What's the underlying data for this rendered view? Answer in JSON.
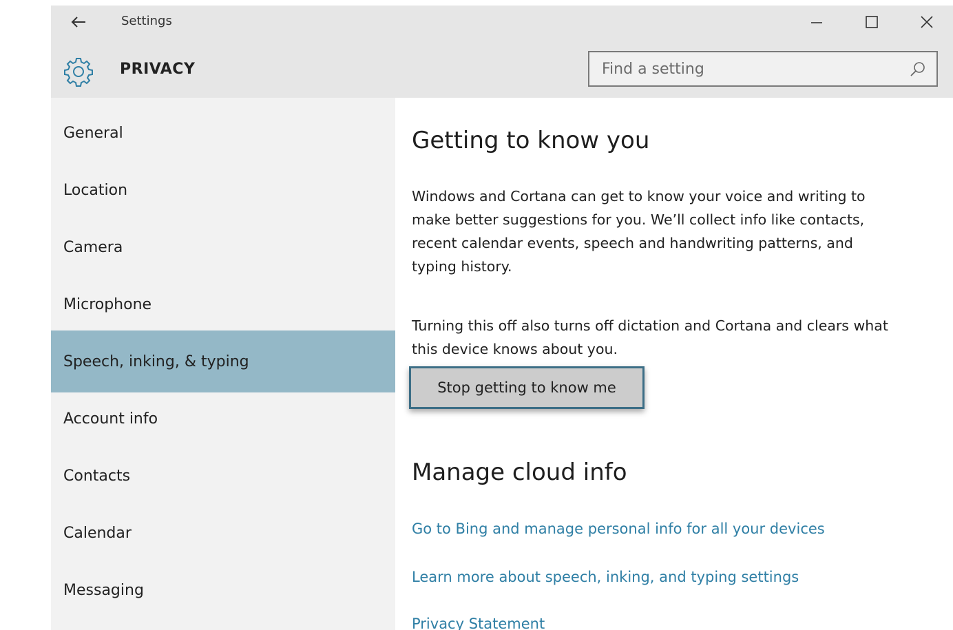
{
  "window": {
    "title": "Settings",
    "controls": {
      "minimize_icon": "minimize-icon",
      "maximize_icon": "maximize-icon",
      "close_icon": "close-icon"
    }
  },
  "header": {
    "section_title": "PRIVACY",
    "icon": "gear-icon"
  },
  "search": {
    "placeholder": "Find a setting",
    "value": ""
  },
  "sidebar": {
    "items": [
      {
        "label": "General"
      },
      {
        "label": "Location"
      },
      {
        "label": "Camera"
      },
      {
        "label": "Microphone"
      },
      {
        "label": "Speech, inking, & typing",
        "selected": true
      },
      {
        "label": "Account info"
      },
      {
        "label": "Contacts"
      },
      {
        "label": "Calendar"
      },
      {
        "label": "Messaging"
      }
    ]
  },
  "main": {
    "getting_to_know": {
      "heading": "Getting to know you",
      "description_lines": [
        "Windows and Cortana can get to know your voice and writing to",
        "make better suggestions for you. We’ll collect info like contacts,",
        "recent calendar events, speech and handwriting patterns, and",
        "typing history."
      ],
      "warning_lines": [
        "Turning this off also turns off dictation and Cortana and clears what",
        "this device knows about you."
      ],
      "button_label": "Stop getting to know me"
    },
    "cloud": {
      "heading": "Manage cloud info",
      "links": [
        "Go to Bing and manage personal info for all your devices",
        "Learn more about speech, inking, and typing settings",
        "Privacy Statement"
      ]
    }
  },
  "colors": {
    "chrome": "#e6e6e6",
    "sidebar": "#f2f2f2",
    "selected": "#94b8c7",
    "link": "#2f7fa5",
    "button": "#cccccc",
    "button_border": "#3c6e86"
  }
}
